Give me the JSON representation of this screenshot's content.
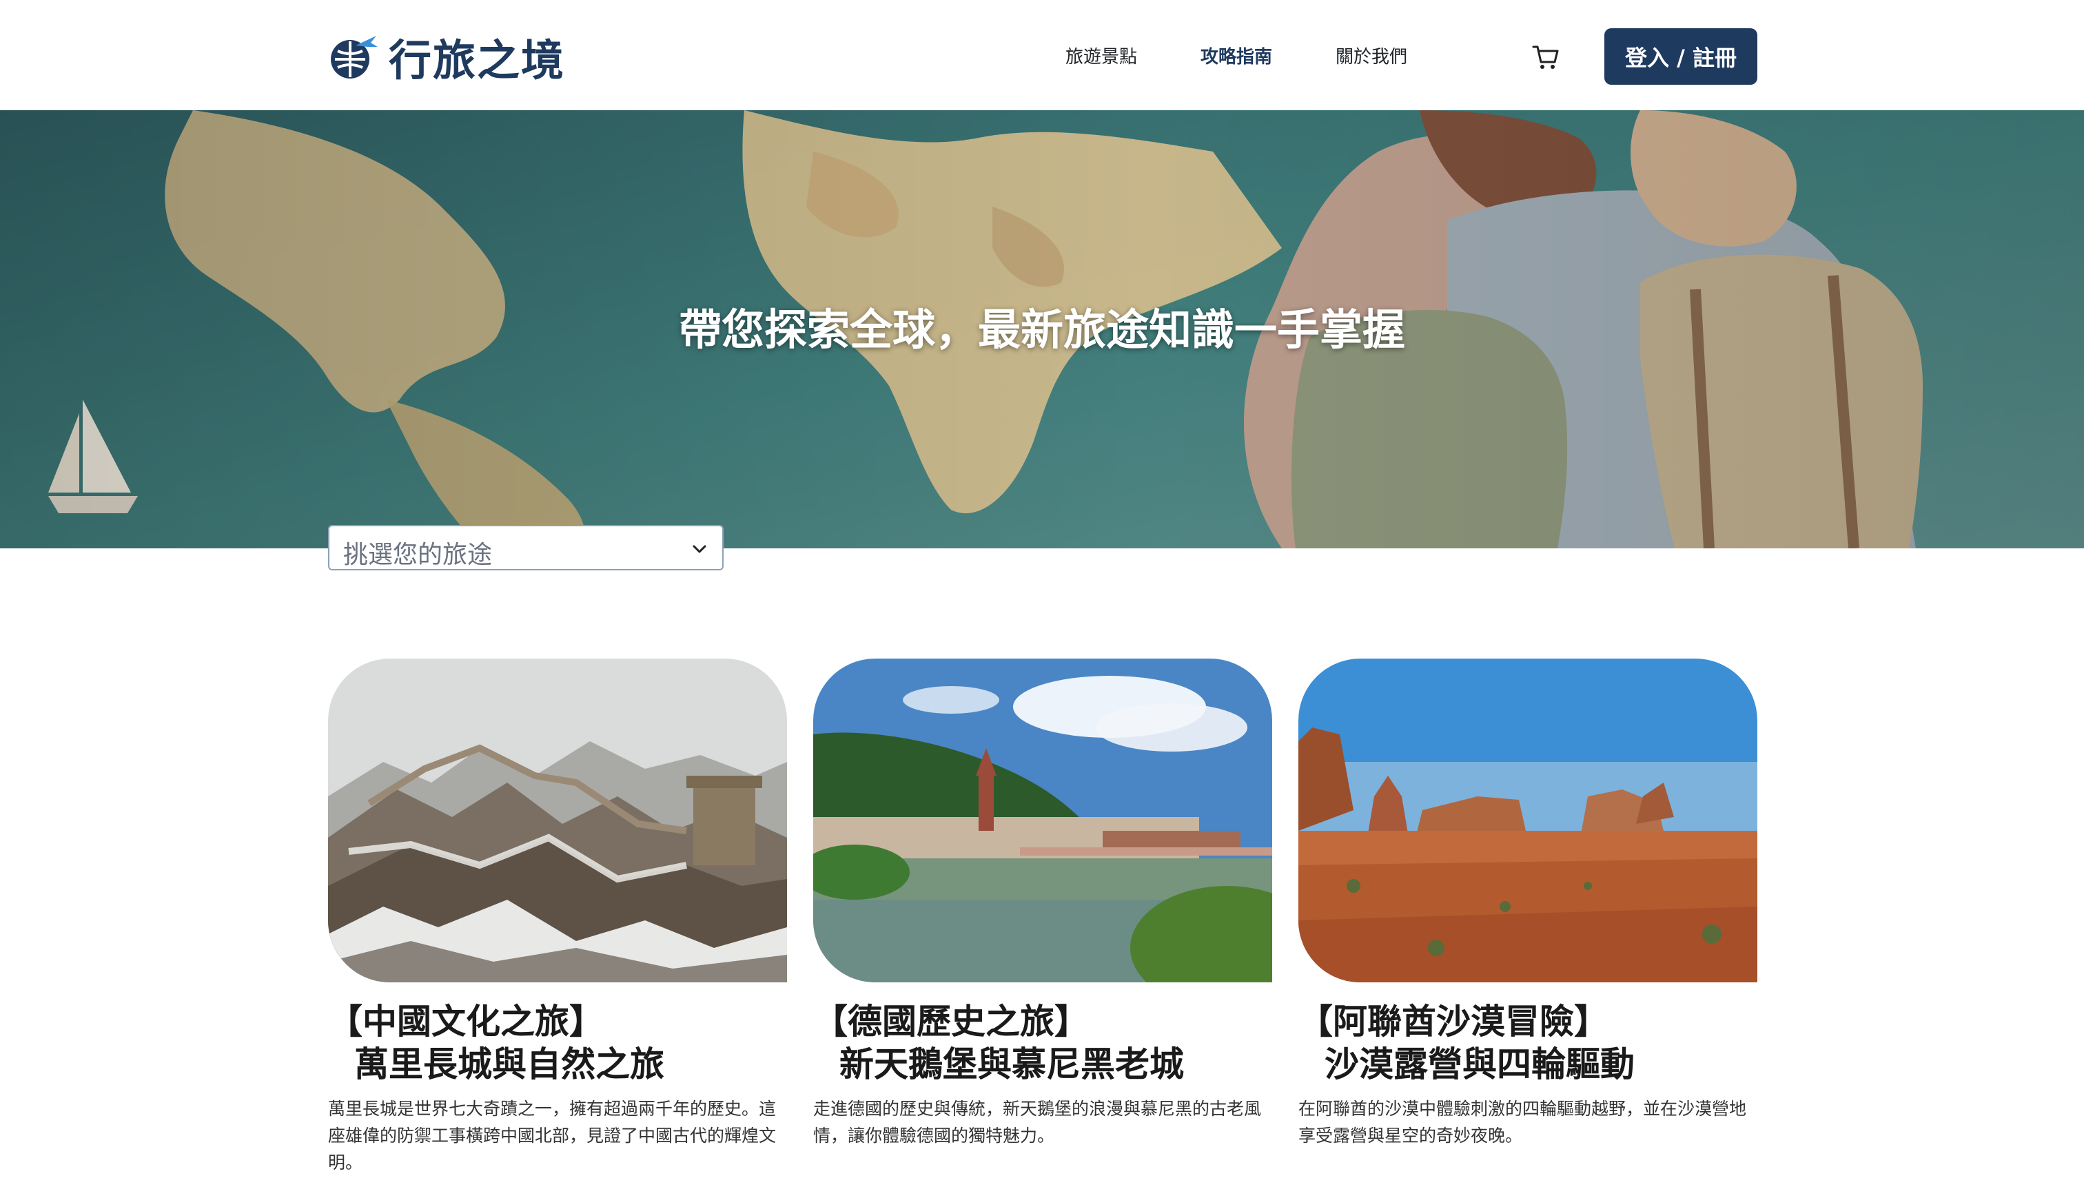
{
  "brand": {
    "name": "行旅之境",
    "accent": "#1f3a5f"
  },
  "nav": {
    "items": [
      {
        "label": "旅遊景點",
        "active": false
      },
      {
        "label": "攻略指南",
        "active": true
      },
      {
        "label": "關於我們",
        "active": false
      }
    ],
    "cart_icon": "cart-icon",
    "login_label": "登入 / 註冊"
  },
  "hero": {
    "title": "帶您探索全球，最新旅途知識一手掌握"
  },
  "trip_select": {
    "value": "挑選您的旅途",
    "icon": "chevron-down-icon"
  },
  "cards": [
    {
      "title": "【中國文化之旅】",
      "subtitle": "萬里長城與自然之旅",
      "description": "萬里長城是世界七大奇蹟之一，擁有超過兩千年的歷史。這座雄偉的防禦工事橫跨中國北部，見證了中國古代的輝煌文明。"
    },
    {
      "title": "【德國歷史之旅】",
      "subtitle": "新天鵝堡與慕尼黑老城",
      "description": "走進德國的歷史與傳統，新天鵝堡的浪漫與慕尼黑的古老風情，讓你體驗德國的獨特魅力。"
    },
    {
      "title": "【阿聯酋沙漠冒險】",
      "subtitle": "沙漠露營與四輪驅動",
      "description": "在阿聯酋的沙漠中體驗刺激的四輪驅動越野，並在沙漠營地享受露營與星空的奇妙夜晚。"
    }
  ]
}
